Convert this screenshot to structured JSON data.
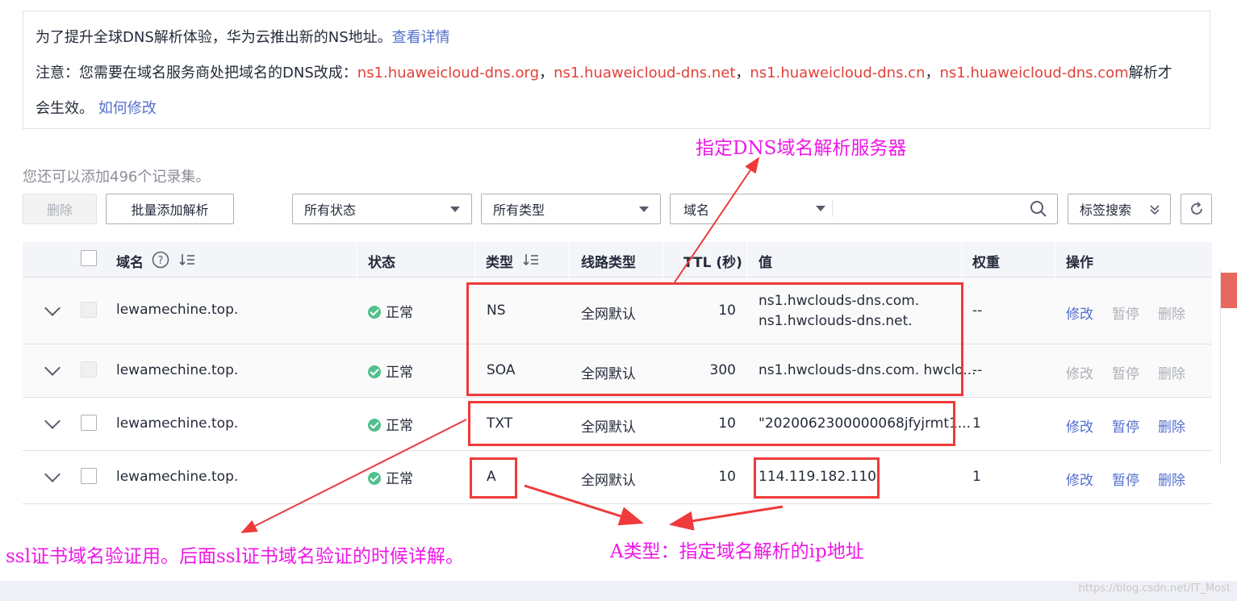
{
  "notice": {
    "line1_text": "为了提升全球DNS解析体验，华为云推出新的NS地址。",
    "line1_link": "查看详情",
    "line2_prefix": "注意：您需要在域名服务商处把域名的DNS改成：",
    "ns_servers": [
      "ns1.huaweicloud-dns.org",
      "ns1.huaweicloud-dns.net",
      "ns1.huaweicloud-dns.cn",
      "ns1.huaweicloud-dns.com"
    ],
    "separator": "，",
    "line2_suffix": "解析才",
    "line3_text": "会生效。",
    "line3_link": "如何修改"
  },
  "count_text": "您还可以添加496个记录集。",
  "toolbar": {
    "delete_label": "删除",
    "batch_add_label": "批量添加解析",
    "status_select": "所有状态",
    "type_select": "所有类型",
    "field_select": "域名",
    "search_placeholder": "",
    "tag_search_label": "标签搜索"
  },
  "table": {
    "headers": {
      "domain": "域名",
      "status": "状态",
      "type": "类型",
      "line_type": "线路类型",
      "ttl": "TTL (秒)",
      "value": "值",
      "weight": "权重",
      "actions": "操作"
    },
    "rows": [
      {
        "domain": "lewamechine.top.",
        "status": "正常",
        "type": "NS",
        "line": "全网默认",
        "ttl": "10",
        "value1": "ns1.hwclouds-dns.com.",
        "value2": "ns1.hwclouds-dns.net.",
        "weight": "--",
        "edit": "修改",
        "pause": "暂停",
        "del": "删除"
      },
      {
        "domain": "lewamechine.top.",
        "status": "正常",
        "type": "SOA",
        "line": "全网默认",
        "ttl": "300",
        "value1": "ns1.hwclouds-dns.com. hwclo...",
        "weight": "--",
        "edit": "修改",
        "pause": "暂停",
        "del": "删除"
      },
      {
        "domain": "lewamechine.top.",
        "status": "正常",
        "type": "TXT",
        "line": "全网默认",
        "ttl": "10",
        "value1": "\"2020062300000068jfyjrmt1...",
        "weight": "1",
        "edit": "修改",
        "pause": "暂停",
        "del": "删除"
      },
      {
        "domain": "lewamechine.top.",
        "status": "正常",
        "type": "A",
        "line": "全网默认",
        "ttl": "10",
        "value1": "114.119.182.110",
        "weight": "1",
        "edit": "修改",
        "pause": "暂停",
        "del": "删除"
      }
    ]
  },
  "annotations": {
    "ns_note": "指定DNS域名解析服务器",
    "txt_note": "ssl证书域名验证用。后面ssl证书域名验证的时候详解。",
    "a_note": "A类型：指定域名解析的ip地址"
  },
  "watermark": "https://blog.csdn.net/IT_Most",
  "colors": {
    "link": "#526ecc",
    "ns_red": "#e2403a",
    "annotation": "#ee17e7",
    "box_red": "#ee3a3a",
    "ok_green": "#50c08c"
  }
}
